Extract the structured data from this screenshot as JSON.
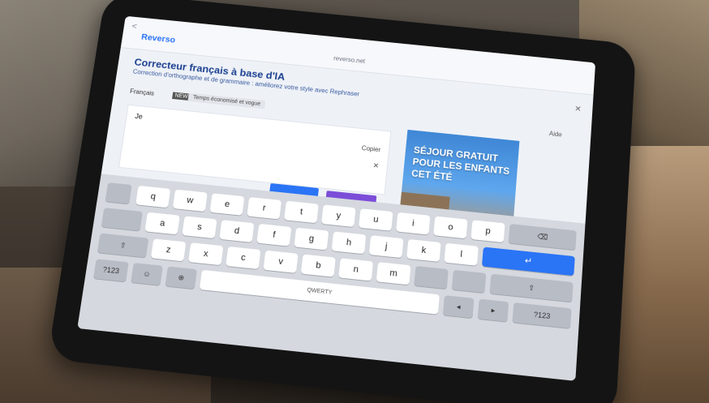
{
  "browser": {
    "brand": "Reverso",
    "brand_sub": "",
    "url": "reverso.net"
  },
  "page": {
    "title": "Correcteur français à base d'IA",
    "subtitle": "Correction d'orthographe et de grammaire : améliorez votre style avec Rephraser",
    "language": "Français",
    "badge": "NEW",
    "feature_chip": "Temps économisé et vogue",
    "help": "Aide"
  },
  "editor": {
    "value": "Je",
    "copy_label": "Copier",
    "hint": ""
  },
  "ad": {
    "text": "SÉJOUR GRATUIT POUR LES ENFANTS CET ÉTÉ"
  },
  "keyboard": {
    "row1": [
      "q",
      "w",
      "e",
      "r",
      "t",
      "y",
      "u",
      "i",
      "o",
      "p"
    ],
    "row2": [
      "a",
      "s",
      "d",
      "f",
      "g",
      "h",
      "j",
      "k",
      "l"
    ],
    "row3": [
      "z",
      "x",
      "c",
      "v",
      "b",
      "n",
      "m"
    ],
    "space_label": "QWERTY",
    "num_label": "?123",
    "enter_label": "↵",
    "backspace_label": "⌫",
    "shift_label": "⇧"
  }
}
